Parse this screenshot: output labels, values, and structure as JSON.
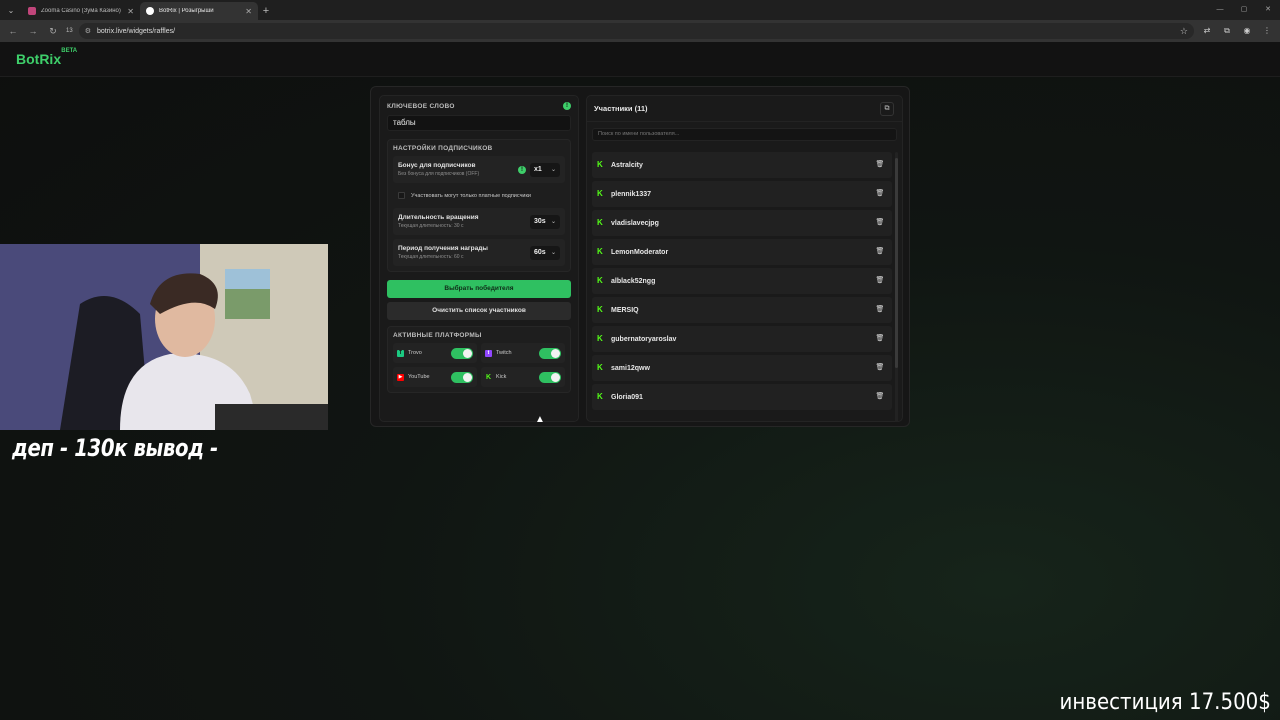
{
  "browser": {
    "tabs": [
      {
        "title": "Zooma Casino (Зума Казино) —",
        "favicon_color": "#c0457a",
        "active": false
      },
      {
        "title": "BotRix | Розыгрыши",
        "favicon_color": "#ffffff",
        "active": true
      }
    ],
    "tab_counter": "13",
    "url": "botrix.live/widgets/raffles/"
  },
  "app": {
    "logo": "BotRix",
    "logo_badge": "BETA",
    "brand_color": "#3ecf6a"
  },
  "settings": {
    "keyword_label": "Ключевое слово",
    "keyword_value": "таблы",
    "subscriber_section_label": "Настройки подписчиков",
    "bonus_title": "Бонус для подписчиков",
    "bonus_subtitle": "Без бонуса для подписчиков (OFF)",
    "bonus_value": "x1",
    "paid_only_label": "Участвовать могут только платные подписчики",
    "spin_title": "Длительность вращения",
    "spin_subtitle": "Текущая длительность: 30 с",
    "spin_value": "30s",
    "reward_title": "Период получения награды",
    "reward_subtitle": "Текущая длительность: 60 с",
    "reward_value": "60s",
    "pick_winner_button": "Выбрать победителя",
    "clear_button": "Очистить список участников",
    "platforms_label": "Активные платформы",
    "platforms": [
      {
        "name": "Trovo",
        "color": "#1bc981",
        "enabled": true
      },
      {
        "name": "Twitch",
        "color": "#9146ff",
        "enabled": true
      },
      {
        "name": "YouTube",
        "color": "#ff0000",
        "enabled": true
      },
      {
        "name": "Kick",
        "color": "#53fc18",
        "enabled": true
      }
    ]
  },
  "participants": {
    "title": "Участники (11)",
    "search_placeholder": "Поиск по имени пользователя...",
    "list": [
      "Astralcity",
      "plennik1337",
      "vladislavecjpg",
      "LemonModerator",
      "alblack52ngg",
      "MERSIQ",
      "gubernatoryaroslav",
      "sami12qww",
      "Gloria091"
    ]
  },
  "stream_overlay": {
    "left_text": "деп - 130к вывод -",
    "right_text": "инвестиция 17.500$"
  }
}
